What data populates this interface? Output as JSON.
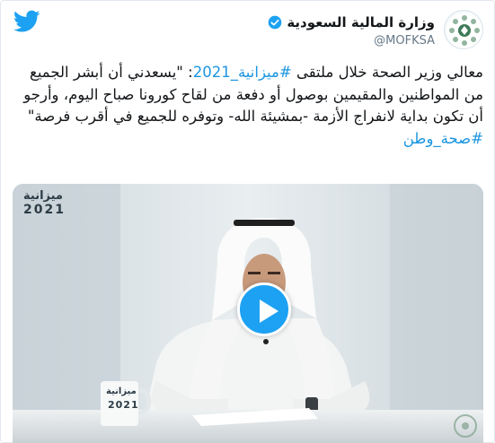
{
  "account": {
    "display_name": "وزارة المالية السعودية",
    "handle": "@MOFKSA",
    "verified": true
  },
  "tweet": {
    "segments": [
      {
        "text": "معالي وزير الصحة خلال ملتقى ",
        "tag": false
      },
      {
        "text": "#ميزانية_2021",
        "tag": true
      },
      {
        "text": ": \"يسعدني أن أبشر الجميع من المواطنين والمقيمين بوصول أو دفعة من لقاح كورونا صباح اليوم، وأرجو أن تكون بداية لانفراج الأزمة -بمشيئة الله- وتوفره للجميع في أقرب فرصة\" ",
        "tag": false
      },
      {
        "text": "#صحة_وطن",
        "tag": true
      }
    ]
  },
  "video": {
    "top_logo_word": "ميزانية",
    "top_logo_year": "2021",
    "mug_logo_word": "ميزانية",
    "mug_logo_year": "2021"
  },
  "icons": {
    "twitter": "twitter-bird-icon",
    "verified": "verified-badge-icon",
    "play": "play-icon"
  },
  "colors": {
    "twitter_blue": "#1da1f2",
    "hashtag_blue": "#1b95e0",
    "handle_gray": "#657786",
    "text": "#14171a"
  }
}
